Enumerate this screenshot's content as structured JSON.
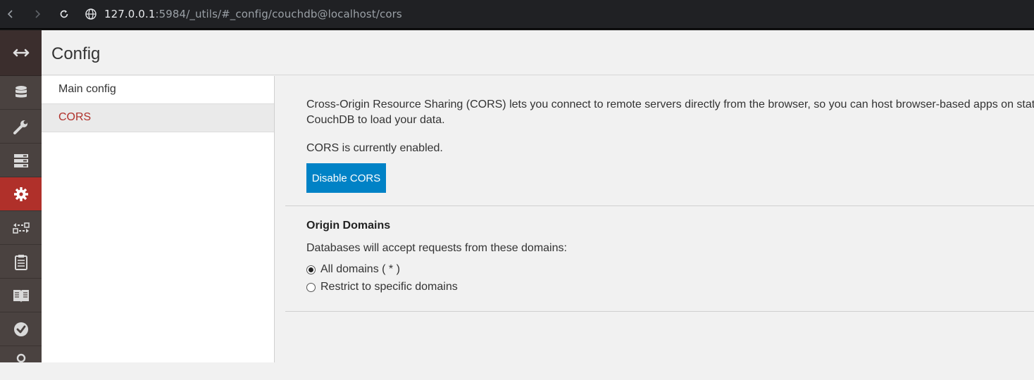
{
  "browser": {
    "url_host": "127.0.0.1",
    "url_rest": ":5984/_utils/#_config/couchdb@localhost/cors"
  },
  "header": {
    "title": "Config"
  },
  "sidebar": {
    "items": [
      {
        "label": "Main config"
      },
      {
        "label": "CORS"
      }
    ]
  },
  "main": {
    "description_line1": "Cross-Origin Resource Sharing (CORS) lets you connect to remote servers directly from the browser, so you can host browser-based apps on static",
    "description_line2": "CouchDB to load your data.",
    "status": "CORS is currently enabled.",
    "disable_button": "Disable CORS",
    "origin_title": "Origin Domains",
    "origin_desc": "Databases will accept requests from these domains:",
    "radio_all": "All domains ( * )",
    "radio_restrict": "Restrict to specific domains"
  },
  "colors": {
    "accent": "#b0302a",
    "button": "#0082c6",
    "rail": "#4a4240"
  }
}
